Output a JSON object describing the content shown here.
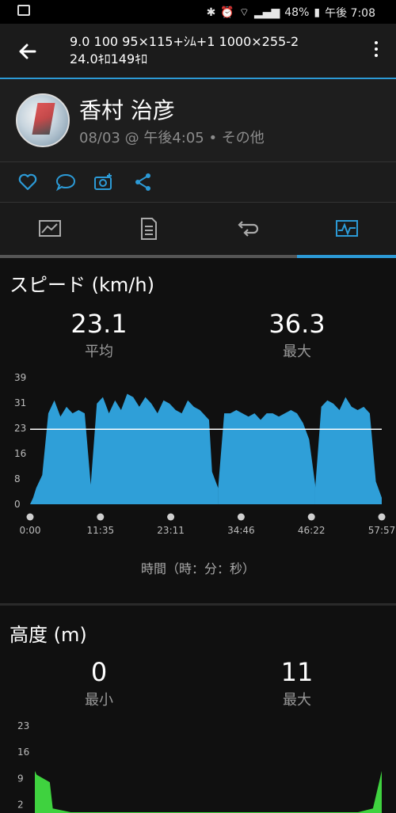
{
  "status": {
    "time": "午後 7:08",
    "battery": "48%"
  },
  "header": {
    "line1": "9.0 100 95×115+ｼﾑ+1 1000×255-2",
    "line2": "24.0ｷﾛ149ｷﾛ"
  },
  "profile": {
    "name": "香村 治彦",
    "subtitle": "08/03 @ 午後4:05 • その他"
  },
  "actions": [
    {
      "icon": "heart-icon"
    },
    {
      "icon": "comment-icon"
    },
    {
      "icon": "camera-add-icon"
    },
    {
      "icon": "share-icon"
    }
  ],
  "tabs": [
    {
      "icon": "map-tab-icon"
    },
    {
      "icon": "details-tab-icon"
    },
    {
      "icon": "laps-tab-icon"
    },
    {
      "icon": "charts-tab-icon",
      "selected": true
    }
  ],
  "speed": {
    "title": "スピード (km/h)",
    "avg_value": "23.1",
    "avg_label": "平均",
    "max_value": "36.3",
    "max_label": "最大",
    "xaxis_label": "時間（時：分：秒）"
  },
  "altitude": {
    "title": "高度 (m)",
    "min_value": "0",
    "min_label": "最小",
    "max_value": "11",
    "max_label": "最大"
  },
  "chart_data": [
    {
      "type": "area",
      "ylim": [
        0,
        39
      ],
      "yticks": [
        "39",
        "31",
        "23",
        "16",
        "8",
        "0"
      ],
      "xticks": [
        "0:00",
        "11:35",
        "23:11",
        "34:46",
        "46:22",
        "57:57"
      ],
      "avg_line": 23.1,
      "fill_color": "#2f9fd8",
      "segments": [
        {
          "x": [
            0.0,
            0.5,
            1.0,
            2.0,
            3.0,
            4.0,
            5.0,
            6.0,
            7.0,
            8.0,
            9.0,
            10.0,
            11.0,
            12.0,
            13.0,
            14.0,
            15.0,
            16.0,
            17.0,
            18.0,
            19.0,
            20.0,
            21.0,
            22.0,
            23.0,
            24.0,
            25.0,
            26.0,
            27.0,
            28.0,
            29.0,
            29.5,
            30.0,
            31.0
          ],
          "y": [
            0,
            2,
            5,
            9,
            28,
            32,
            27,
            30,
            28,
            29,
            28,
            6,
            31,
            33,
            28,
            32,
            29,
            34,
            33,
            30,
            33,
            31,
            28,
            32,
            31,
            29,
            28,
            32,
            30,
            29,
            27,
            26,
            10,
            5
          ]
        },
        {
          "x": [
            31.0,
            32.0,
            33.0,
            34.0,
            35.0,
            36.0,
            37.0,
            38.0,
            39.0,
            40.0,
            41.0,
            42.0,
            43.0,
            44.0,
            45.0,
            46.0,
            47.0
          ],
          "y": [
            5,
            28,
            28,
            29,
            28,
            27,
            28,
            26,
            28,
            28,
            27,
            28,
            29,
            28,
            25,
            20,
            6
          ]
        },
        {
          "x": [
            47.0,
            48.0,
            49.0,
            50.0,
            51.0,
            52.0,
            53.0,
            54.0,
            55.0,
            56.0,
            57.0,
            57.97
          ],
          "y": [
            5,
            30,
            32,
            31,
            29,
            33,
            30,
            29,
            30,
            28,
            7,
            2
          ]
        }
      ]
    },
    {
      "type": "area",
      "ylim": [
        0,
        23
      ],
      "yticks": [
        "23",
        "16",
        "9",
        "2"
      ],
      "fill_color": "#3fd23f",
      "x": [
        0.0,
        0.3,
        2.5,
        3.0,
        6.0,
        50.0,
        54.0,
        56.5,
        57.97
      ],
      "y": [
        11,
        10,
        8,
        1,
        0,
        0,
        0,
        1,
        11
      ]
    }
  ]
}
